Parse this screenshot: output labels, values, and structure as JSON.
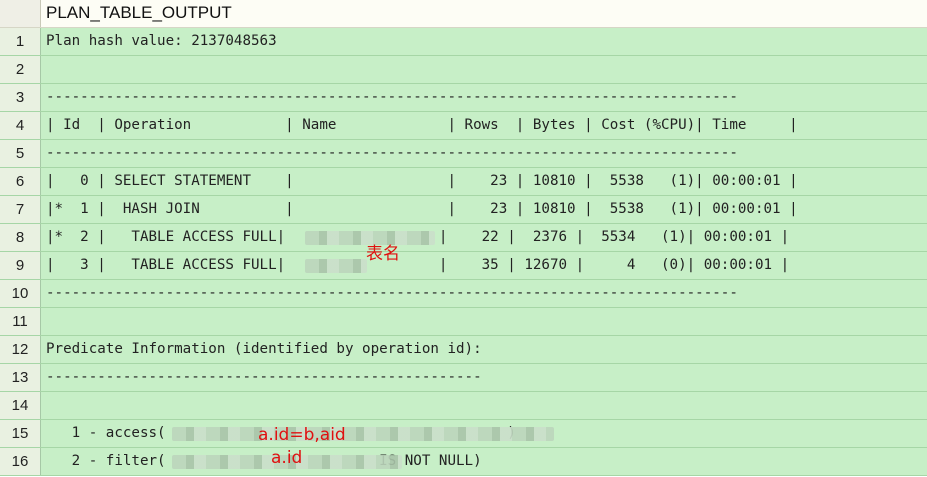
{
  "column_header": "PLAN_TABLE_OUTPUT",
  "rows": [
    {
      "n": "1",
      "text": "Plan hash value: 2137048563"
    },
    {
      "n": "2",
      "text": ""
    },
    {
      "n": "3",
      "text": "---------------------------------------------------------------------------------"
    },
    {
      "n": "4",
      "text": "| Id  | Operation           | Name             | Rows  | Bytes | Cost (%CPU)| Time     |"
    },
    {
      "n": "5",
      "text": "---------------------------------------------------------------------------------"
    },
    {
      "n": "6",
      "text": "|   0 | SELECT STATEMENT    |                  |    23 | 10810 |  5538   (1)| 00:00:01 |"
    },
    {
      "n": "7",
      "text": "|*  1 |  HASH JOIN          |                  |    23 | 10810 |  5538   (1)| 00:00:01 |"
    },
    {
      "n": "8",
      "text": "|*  2 |   TABLE ACCESS FULL|                  |    22 |  2376 |  5534   (1)| 00:00:01 |"
    },
    {
      "n": "9",
      "text": "|   3 |   TABLE ACCESS FULL|                  |    35 | 12670 |     4   (0)| 00:00:01 |"
    },
    {
      "n": "10",
      "text": "---------------------------------------------------------------------------------"
    },
    {
      "n": "11",
      "text": ""
    },
    {
      "n": "12",
      "text": "Predicate Information (identified by operation id):"
    },
    {
      "n": "13",
      "text": "---------------------------------------------------"
    },
    {
      "n": "14",
      "text": ""
    },
    {
      "n": "15",
      "text": "   1 - access(                                        )"
    },
    {
      "n": "16",
      "text": "   2 - filter(                         IS NOT NULL)"
    }
  ],
  "annotations": {
    "table_name": "表名",
    "join_condition": "a.id=b,aid",
    "filter_column": "a.id"
  },
  "colors": {
    "row_bg": "#c7efc7",
    "header_bg": "#fdfdf5",
    "annotation": "#e01010"
  }
}
